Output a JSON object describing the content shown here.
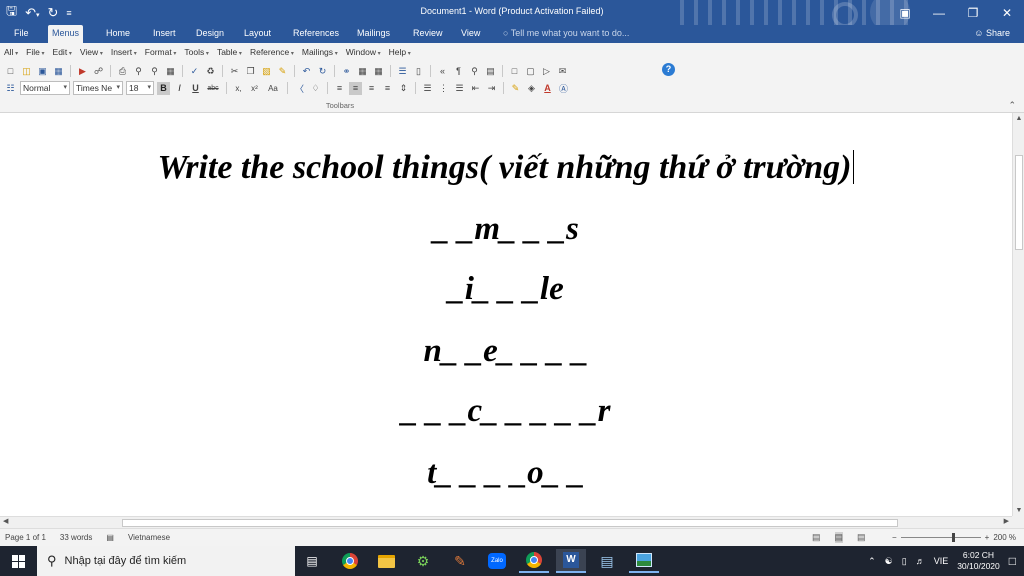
{
  "window": {
    "title": "Document1 - Word (Product Activation Failed)",
    "qat": [
      "save-icon",
      "undo-icon",
      "redo-icon",
      "customize-icon"
    ],
    "controls": [
      "restore-ribbon-icon",
      "minimize-icon",
      "maximize-icon",
      "close-icon"
    ]
  },
  "ribbon_tabs": [
    {
      "label": "File",
      "active": false
    },
    {
      "label": "Menus",
      "active": true
    },
    {
      "label": "Home",
      "active": false
    },
    {
      "label": "Insert",
      "active": false
    },
    {
      "label": "Design",
      "active": false
    },
    {
      "label": "Layout",
      "active": false
    },
    {
      "label": "References",
      "active": false
    },
    {
      "label": "Mailings",
      "active": false
    },
    {
      "label": "Review",
      "active": false
    },
    {
      "label": "View",
      "active": false
    }
  ],
  "tell_me": "Tell me what you want to do...",
  "share_label": "Share",
  "menubar": [
    "All",
    "File",
    "Edit",
    "View",
    "Insert",
    "Format",
    "Tools",
    "Table",
    "Reference",
    "Mailings",
    "Window",
    "Help"
  ],
  "formatting": {
    "style": "Normal",
    "font": "Times Ne",
    "size": "18",
    "bold": "B",
    "italic": "I",
    "underline": "U",
    "strike": "abc",
    "subscript": "x,",
    "superscript": "x²",
    "change_case": "Aa"
  },
  "toolbars_caption": "Toolbars",
  "document": {
    "heading": "Write the school things( viết những thứ ở trường)",
    "words": [
      "_ _m_ _ _s",
      "_i_ _ _le",
      "n_ _e_ _ _ _",
      "_ _ _c_ _ _ _ _r",
      "t_ _ _ _o_ _"
    ]
  },
  "status": {
    "page": "Page 1 of 1",
    "words": "33 words",
    "language": "Vietnamese",
    "zoom_minus": "−",
    "zoom_plus": "+",
    "zoom": "200 %",
    "zoom_level": 0.65
  },
  "taskbar": {
    "search_placeholder": "Nhập tại đây để tìm kiếm",
    "zalo_label": "Zalo",
    "word_label": "W",
    "input_lang": "VIE",
    "time": "6:02 CH",
    "date": "30/10/2020"
  }
}
